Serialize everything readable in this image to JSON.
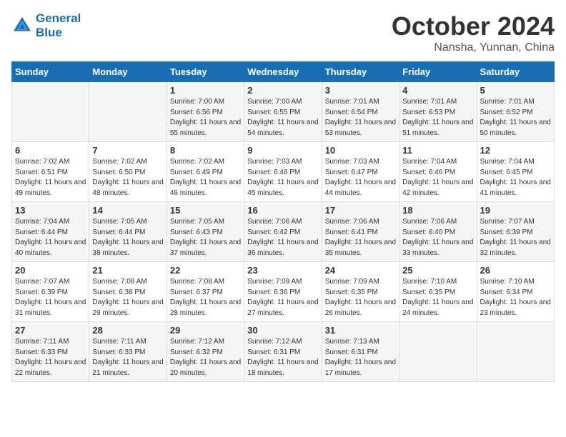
{
  "header": {
    "logo_line1": "General",
    "logo_line2": "Blue",
    "month": "October 2024",
    "location": "Nansha, Yunnan, China"
  },
  "days_of_week": [
    "Sunday",
    "Monday",
    "Tuesday",
    "Wednesday",
    "Thursday",
    "Friday",
    "Saturday"
  ],
  "weeks": [
    [
      {
        "day": "",
        "info": ""
      },
      {
        "day": "",
        "info": ""
      },
      {
        "day": "1",
        "info": "Sunrise: 7:00 AM\nSunset: 6:56 PM\nDaylight: 11 hours and 55 minutes."
      },
      {
        "day": "2",
        "info": "Sunrise: 7:00 AM\nSunset: 6:55 PM\nDaylight: 11 hours and 54 minutes."
      },
      {
        "day": "3",
        "info": "Sunrise: 7:01 AM\nSunset: 6:54 PM\nDaylight: 11 hours and 53 minutes."
      },
      {
        "day": "4",
        "info": "Sunrise: 7:01 AM\nSunset: 6:53 PM\nDaylight: 11 hours and 51 minutes."
      },
      {
        "day": "5",
        "info": "Sunrise: 7:01 AM\nSunset: 6:52 PM\nDaylight: 11 hours and 50 minutes."
      }
    ],
    [
      {
        "day": "6",
        "info": "Sunrise: 7:02 AM\nSunset: 6:51 PM\nDaylight: 11 hours and 49 minutes."
      },
      {
        "day": "7",
        "info": "Sunrise: 7:02 AM\nSunset: 6:50 PM\nDaylight: 11 hours and 48 minutes."
      },
      {
        "day": "8",
        "info": "Sunrise: 7:02 AM\nSunset: 6:49 PM\nDaylight: 11 hours and 46 minutes."
      },
      {
        "day": "9",
        "info": "Sunrise: 7:03 AM\nSunset: 6:48 PM\nDaylight: 11 hours and 45 minutes."
      },
      {
        "day": "10",
        "info": "Sunrise: 7:03 AM\nSunset: 6:47 PM\nDaylight: 11 hours and 44 minutes."
      },
      {
        "day": "11",
        "info": "Sunrise: 7:04 AM\nSunset: 6:46 PM\nDaylight: 11 hours and 42 minutes."
      },
      {
        "day": "12",
        "info": "Sunrise: 7:04 AM\nSunset: 6:45 PM\nDaylight: 11 hours and 41 minutes."
      }
    ],
    [
      {
        "day": "13",
        "info": "Sunrise: 7:04 AM\nSunset: 6:44 PM\nDaylight: 11 hours and 40 minutes."
      },
      {
        "day": "14",
        "info": "Sunrise: 7:05 AM\nSunset: 6:44 PM\nDaylight: 11 hours and 38 minutes."
      },
      {
        "day": "15",
        "info": "Sunrise: 7:05 AM\nSunset: 6:43 PM\nDaylight: 11 hours and 37 minutes."
      },
      {
        "day": "16",
        "info": "Sunrise: 7:06 AM\nSunset: 6:42 PM\nDaylight: 11 hours and 36 minutes."
      },
      {
        "day": "17",
        "info": "Sunrise: 7:06 AM\nSunset: 6:41 PM\nDaylight: 11 hours and 35 minutes."
      },
      {
        "day": "18",
        "info": "Sunrise: 7:06 AM\nSunset: 6:40 PM\nDaylight: 11 hours and 33 minutes."
      },
      {
        "day": "19",
        "info": "Sunrise: 7:07 AM\nSunset: 6:39 PM\nDaylight: 11 hours and 32 minutes."
      }
    ],
    [
      {
        "day": "20",
        "info": "Sunrise: 7:07 AM\nSunset: 6:39 PM\nDaylight: 11 hours and 31 minutes."
      },
      {
        "day": "21",
        "info": "Sunrise: 7:08 AM\nSunset: 6:38 PM\nDaylight: 11 hours and 29 minutes."
      },
      {
        "day": "22",
        "info": "Sunrise: 7:08 AM\nSunset: 6:37 PM\nDaylight: 11 hours and 28 minutes."
      },
      {
        "day": "23",
        "info": "Sunrise: 7:09 AM\nSunset: 6:36 PM\nDaylight: 11 hours and 27 minutes."
      },
      {
        "day": "24",
        "info": "Sunrise: 7:09 AM\nSunset: 6:35 PM\nDaylight: 11 hours and 26 minutes."
      },
      {
        "day": "25",
        "info": "Sunrise: 7:10 AM\nSunset: 6:35 PM\nDaylight: 11 hours and 24 minutes."
      },
      {
        "day": "26",
        "info": "Sunrise: 7:10 AM\nSunset: 6:34 PM\nDaylight: 11 hours and 23 minutes."
      }
    ],
    [
      {
        "day": "27",
        "info": "Sunrise: 7:11 AM\nSunset: 6:33 PM\nDaylight: 11 hours and 22 minutes."
      },
      {
        "day": "28",
        "info": "Sunrise: 7:11 AM\nSunset: 6:33 PM\nDaylight: 11 hours and 21 minutes."
      },
      {
        "day": "29",
        "info": "Sunrise: 7:12 AM\nSunset: 6:32 PM\nDaylight: 11 hours and 20 minutes."
      },
      {
        "day": "30",
        "info": "Sunrise: 7:12 AM\nSunset: 6:31 PM\nDaylight: 11 hours and 18 minutes."
      },
      {
        "day": "31",
        "info": "Sunrise: 7:13 AM\nSunset: 6:31 PM\nDaylight: 11 hours and 17 minutes."
      },
      {
        "day": "",
        "info": ""
      },
      {
        "day": "",
        "info": ""
      }
    ]
  ]
}
